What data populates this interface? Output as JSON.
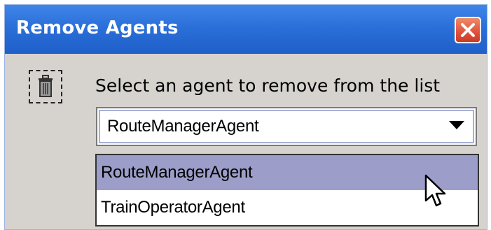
{
  "window": {
    "title": "Remove Agents"
  },
  "icons": {
    "close": "close-icon",
    "trash": "trash-icon",
    "dropdown_arrow": "chevron-down-icon",
    "cursor": "mouse-pointer-icon"
  },
  "colors": {
    "titlebar": "#2b6fd9",
    "close_button": "#e0513a",
    "selected_item": "#9c9ec9",
    "window_bg": "#d6d3ce"
  },
  "prompt": "Select an agent to remove from the list",
  "combo": {
    "selected_value": "RouteManagerAgent"
  },
  "list": {
    "items": [
      {
        "label": "RouteManagerAgent",
        "selected": true
      },
      {
        "label": "TrainOperatorAgent",
        "selected": false
      }
    ]
  }
}
